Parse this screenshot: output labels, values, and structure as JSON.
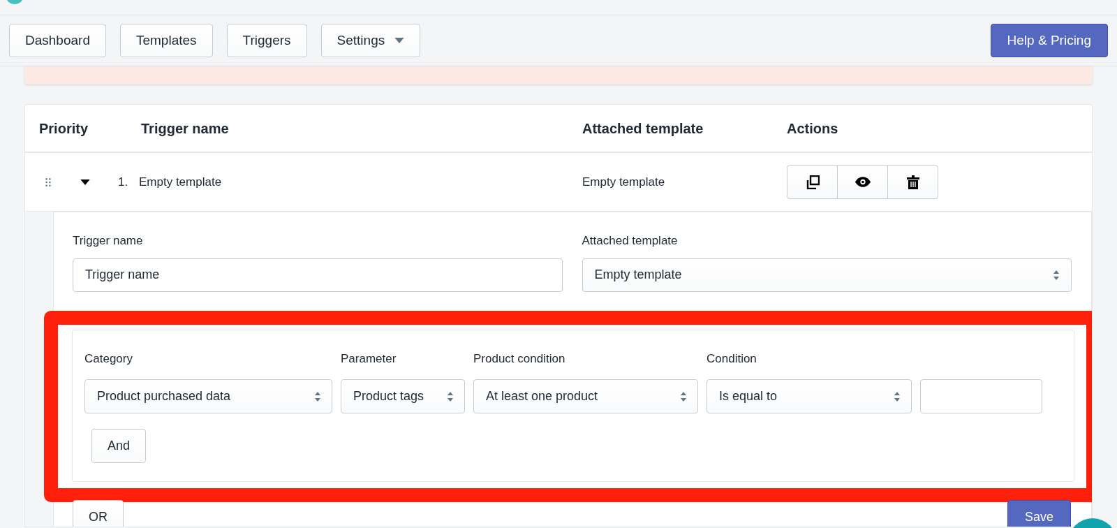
{
  "nav": {
    "buttons": [
      {
        "label": "Dashboard",
        "kind": "button"
      },
      {
        "label": "Templates",
        "kind": "button"
      },
      {
        "label": "Triggers",
        "kind": "button"
      },
      {
        "label": "Settings",
        "kind": "dropdown"
      }
    ],
    "help_button": "Help & Pricing"
  },
  "table": {
    "columns": [
      "Priority",
      "Trigger name",
      "Attached template",
      "Actions"
    ],
    "rows": [
      {
        "priority": "1.",
        "trigger_name": "Empty template",
        "attached_template": "Empty template",
        "expanded": true
      }
    ]
  },
  "editor": {
    "trigger_name_label": "Trigger name",
    "trigger_name_value": "Trigger name",
    "template_label": "Attached template",
    "template_value": "Empty template",
    "conditions": [
      {
        "kind": "select",
        "label": "Category",
        "value": "Product purchased data"
      },
      {
        "kind": "select",
        "label": "Parameter",
        "value": "Product tags"
      },
      {
        "kind": "select",
        "label": "Product condition",
        "value": "At least one product"
      },
      {
        "kind": "select",
        "label": "Condition",
        "value": "Is equal to"
      },
      {
        "kind": "text"
      }
    ],
    "and_button": "And",
    "or_button": "OR",
    "save_button": "Save"
  }
}
